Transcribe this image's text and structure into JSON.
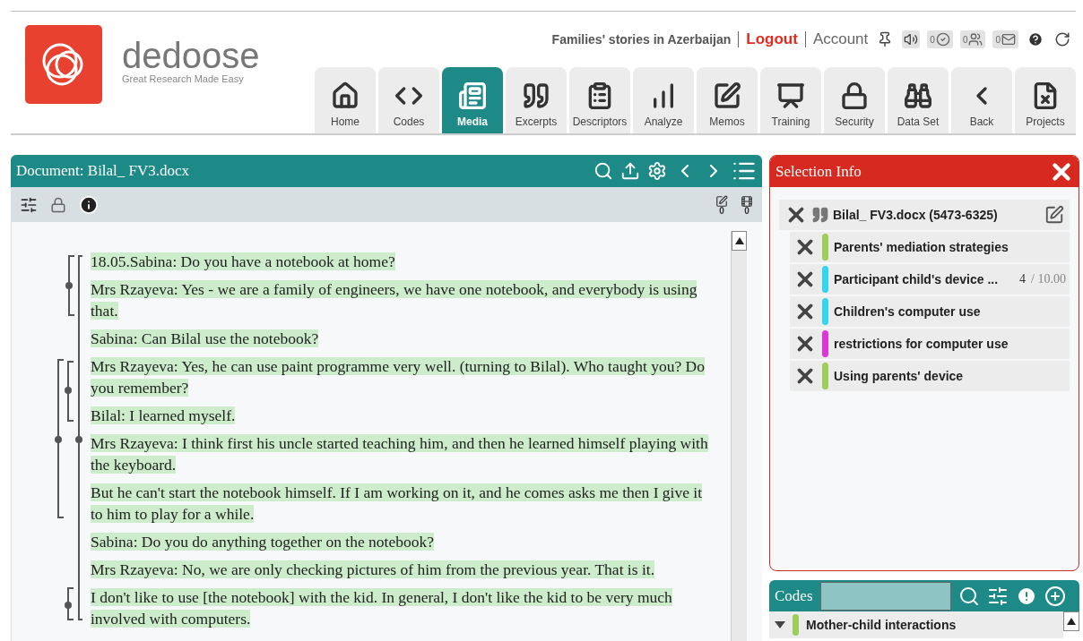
{
  "logo": {
    "name": "dedoose",
    "tagline": "Great Research Made Easy"
  },
  "header": {
    "project": "Families' stories in Azerbaijan",
    "links": [
      {
        "label": "Logout",
        "kind": "logout"
      },
      {
        "label": "Account",
        "kind": "account"
      }
    ],
    "badges": [
      {
        "count": "0",
        "kind": "check"
      },
      {
        "count": "0",
        "kind": "people"
      },
      {
        "count": "0",
        "kind": "mail"
      }
    ]
  },
  "nav": [
    {
      "label": "Home",
      "selected": false
    },
    {
      "label": "Codes",
      "selected": false
    },
    {
      "label": "Media",
      "selected": true
    },
    {
      "label": "Excerpts",
      "selected": false
    },
    {
      "label": "Descriptors",
      "selected": false
    },
    {
      "label": "Analyze",
      "selected": false
    },
    {
      "label": "Memos",
      "selected": false
    },
    {
      "label": "Training",
      "selected": false
    },
    {
      "label": "Security",
      "selected": false
    },
    {
      "label": "Data Set",
      "selected": false
    },
    {
      "label": "Back",
      "selected": false
    },
    {
      "label": "Projects",
      "selected": false
    }
  ],
  "document": {
    "title": "Document: Bilal_ FV3.docx",
    "memo_count": "0",
    "excerpt_count": "0",
    "paragraphs": [
      "18.05.Sabina: Do you have a notebook at home?",
      "Mrs Rzayeva: Yes - we are a family of engineers, we have one notebook, and everybody is using that.",
      "Sabina: Can Bilal use the notebook?",
      "Mrs Rzayeva: Yes, he can use paint programme very well. (turning to Bilal). Who taught you? Do you remember?",
      "Bilal: I learned myself.",
      "Mrs Rzayeva: I think first his uncle started teaching him, and then he learned himself playing with the keyboard.",
      "But he can't start the notebook himself. If I am working on it, and he comes asks me then I give it to him to play for a while.",
      "Sabina: Do you do anything together on the notebook?",
      "Mrs Rzayeva: No, we are only checking pictures of him from the previous year. That is it.",
      "I don't like to use [the notebook] with the kid. In general, I don't  like the kid to be very much involved with computers."
    ]
  },
  "selection_info": {
    "title": "Selection Info",
    "excerpt": "Bilal_ FV3.docx (5473-6325)",
    "codes": [
      {
        "name": "Parents' mediation strategies",
        "color": "#9ccc5a"
      },
      {
        "name": "Participant child's device ...",
        "color": "#33d6ee",
        "weight": "4",
        "weight_max": "/ 10.00"
      },
      {
        "name": "Children's computer use",
        "color": "#33d6ee"
      },
      {
        "name": "restrictions for computer use",
        "color": "#e233d6"
      },
      {
        "name": "Using parents' device",
        "color": "#9ccc5a"
      }
    ]
  },
  "codes_panel": {
    "title": "Codes",
    "tree": [
      {
        "name": "Mother-child interactions",
        "color": "#9ccc5a",
        "expanded": true
      }
    ]
  }
}
